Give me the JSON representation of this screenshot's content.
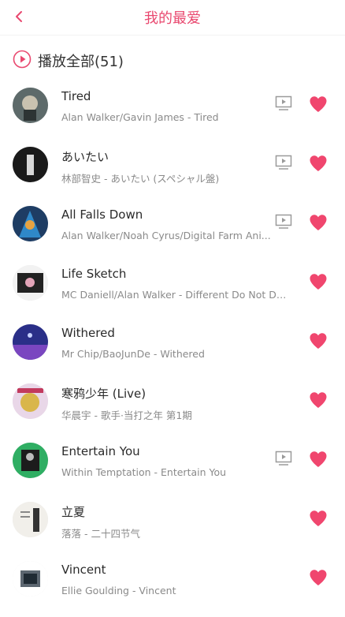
{
  "header": {
    "title": "我的最爱"
  },
  "play_all": {
    "label": "播放全部(51)"
  },
  "colors": {
    "accent": "#e9486f",
    "heart": "#f0466e",
    "mv_icon": "#9a9a9a"
  },
  "songs": [
    {
      "title": "Tired",
      "subtitle": "Alan Walker/Gavin James - Tired",
      "has_mv": true
    },
    {
      "title": "あいたい",
      "subtitle": "林部智史 - あいたい (スペシャル盤)",
      "has_mv": true
    },
    {
      "title": "All Falls Down",
      "subtitle": "Alan Walker/Noah Cyrus/Digital Farm Ani...",
      "has_mv": true
    },
    {
      "title": "Life Sketch",
      "subtitle": "MC Daniell/Alan Walker - Different Do Not Deliver",
      "has_mv": false
    },
    {
      "title": "Withered",
      "subtitle": "Mr Chip/BaoJunDe - Withered",
      "has_mv": false
    },
    {
      "title": "寒鸦少年 (Live)",
      "subtitle": "华晨宇 - 歌手·当打之年 第1期",
      "has_mv": false
    },
    {
      "title": "Entertain You",
      "subtitle": "Within Temptation - Entertain You",
      "has_mv": true
    },
    {
      "title": "立夏",
      "subtitle": "落落 - 二十四节气",
      "has_mv": false
    },
    {
      "title": "Vincent",
      "subtitle": "Ellie Goulding - Vincent",
      "has_mv": false
    }
  ]
}
